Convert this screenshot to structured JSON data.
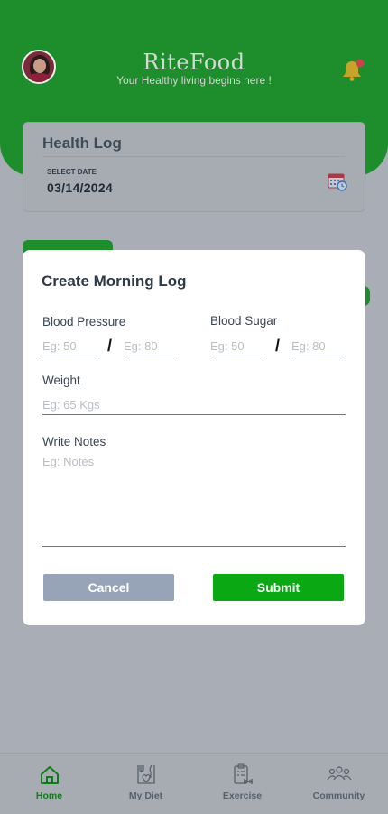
{
  "header": {
    "brand": "RiteFood",
    "tagline": "Your Healthy living begins here !"
  },
  "health_log": {
    "title": "Health Log",
    "date_label": "SELECT DATE",
    "date_value": "03/14/2024"
  },
  "modal": {
    "title": "Create Morning Log",
    "blood_pressure": {
      "label": "Blood Pressure",
      "placeholder_1": "Eg: 50",
      "placeholder_2": "Eg: 80",
      "separator": "/"
    },
    "blood_sugar": {
      "label": "Blood Sugar",
      "placeholder_1": "Eg: 50",
      "placeholder_2": "Eg: 80",
      "separator": "/"
    },
    "weight": {
      "label": "Weight",
      "placeholder": "Eg: 65 Kgs"
    },
    "notes": {
      "label": "Write Notes",
      "placeholder": "Eg: Notes"
    },
    "cancel_label": "Cancel",
    "submit_label": "Submit"
  },
  "bottom_nav": {
    "items": [
      {
        "label": "Home",
        "icon": "home-icon",
        "active": true
      },
      {
        "label": "My Diet",
        "icon": "diet-icon",
        "active": false
      },
      {
        "label": "Exercise",
        "icon": "exercise-icon",
        "active": false
      },
      {
        "label": "Community",
        "icon": "community-icon",
        "active": false
      }
    ]
  },
  "colors": {
    "brand_green": "#1e8d2c",
    "submit_green": "#0aa812",
    "cancel_gray": "#97a3b7",
    "overlay": "#a9aeb6"
  }
}
